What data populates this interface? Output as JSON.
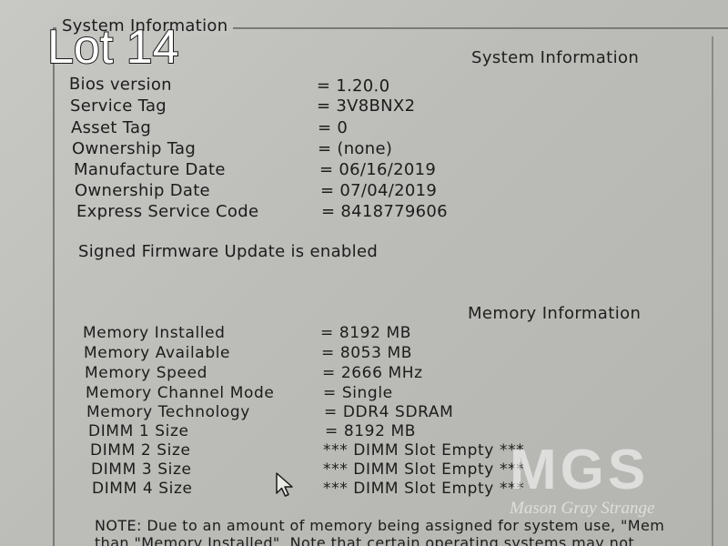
{
  "overlay": {
    "lot_label": "Lot 14"
  },
  "group_legend": "System Information",
  "system_info": {
    "title": "System Information",
    "rows": [
      {
        "label": "Bios version",
        "value": "= 1.20.0"
      },
      {
        "label": "Service Tag",
        "value": "= 3V8BNX2"
      },
      {
        "label": "Asset Tag",
        "value": "= 0"
      },
      {
        "label": "Ownership Tag",
        "value": "= (none)"
      },
      {
        "label": "Manufacture Date",
        "value": "= 06/16/2019"
      },
      {
        "label": "Ownership Date",
        "value": "= 07/04/2019"
      },
      {
        "label": "Express Service Code",
        "value": "= 8418779606"
      }
    ],
    "firmware_status": "Signed Firmware Update is enabled"
  },
  "memory_info": {
    "title": "Memory Information",
    "rows": [
      {
        "label": "Memory Installed",
        "value": "= 8192 MB"
      },
      {
        "label": "Memory Available",
        "value": "= 8053 MB"
      },
      {
        "label": "Memory Speed",
        "value": "= 2666 MHz"
      },
      {
        "label": "Memory Channel Mode",
        "value": "= Single"
      },
      {
        "label": "Memory Technology",
        "value": "= DDR4 SDRAM"
      },
      {
        "label": "DIMM 1 Size",
        "value": "= 8192 MB"
      },
      {
        "label": "DIMM 2 Size",
        "value": "*** DIMM Slot Empty ***"
      },
      {
        "label": "DIMM 3 Size",
        "value": "*** DIMM Slot Empty ***"
      },
      {
        "label": "DIMM 4 Size",
        "value": "*** DIMM Slot Empty ***"
      }
    ],
    "note_line1": "NOTE: Due to an amount of memory being assigned for system use, \"Mem",
    "note_line2": "than \"Memory Installed\". Note that certain operating systems may not"
  },
  "watermark": {
    "letters": "MGS",
    "name": "Mason Gray Strange"
  },
  "icons": {
    "cursor": "mouse-pointer-icon"
  }
}
